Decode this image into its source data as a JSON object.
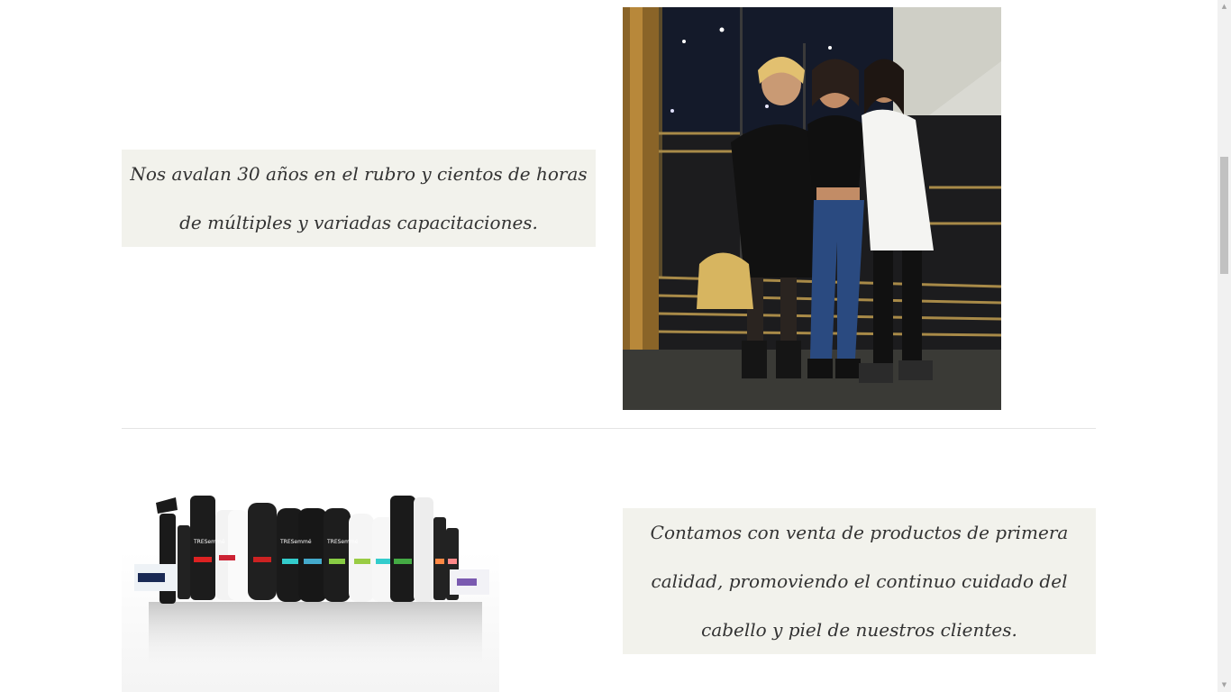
{
  "sections": [
    {
      "text": "Nos avalan 30 años en el rubro y cientos de horas de múltiples y variadas capacitaciones.",
      "image": "team-photo"
    },
    {
      "text": "Contamos con venta de productos de primera calidad, promoviendo el continuo cuidado del cabello y piel de nuestros clientes.",
      "image": "tresemme-products-photo"
    }
  ],
  "colors": {
    "quote_bg": "#f2f2ec",
    "quote_text": "#333333",
    "divider": "#e4e4e4"
  },
  "products_image": {
    "brand_label": "TRESemmé"
  },
  "scrollbar": {
    "up_icon": "triangle-up-icon",
    "down_icon": "triangle-down-icon"
  }
}
